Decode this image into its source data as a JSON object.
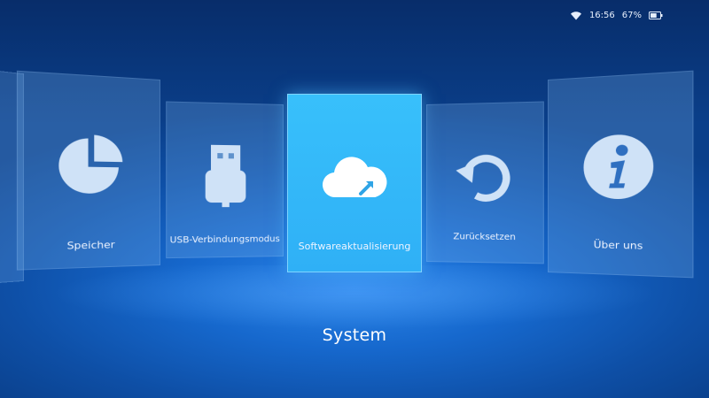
{
  "status_bar": {
    "wifi_icon": "wifi-icon",
    "time": "16:56",
    "battery_percent": "67%",
    "battery_level": 0.67
  },
  "menu": {
    "items": [
      {
        "label": "",
        "icon": "hidden-card"
      },
      {
        "label": "Speicher",
        "icon": "pie-chart-icon"
      },
      {
        "label": "USB-Verbindungsmodus",
        "icon": "usb-icon"
      },
      {
        "label": "Softwareaktualisierung",
        "icon": "cloud-update-icon",
        "selected": true
      },
      {
        "label": "Zurücksetzen",
        "icon": "reset-icon"
      },
      {
        "label": "Über uns",
        "icon": "info-icon"
      }
    ]
  },
  "page_title": "System",
  "colors": {
    "selected_card": "#38c0fb",
    "card_icon": "#cfe2f7",
    "background": "#1668cd"
  }
}
